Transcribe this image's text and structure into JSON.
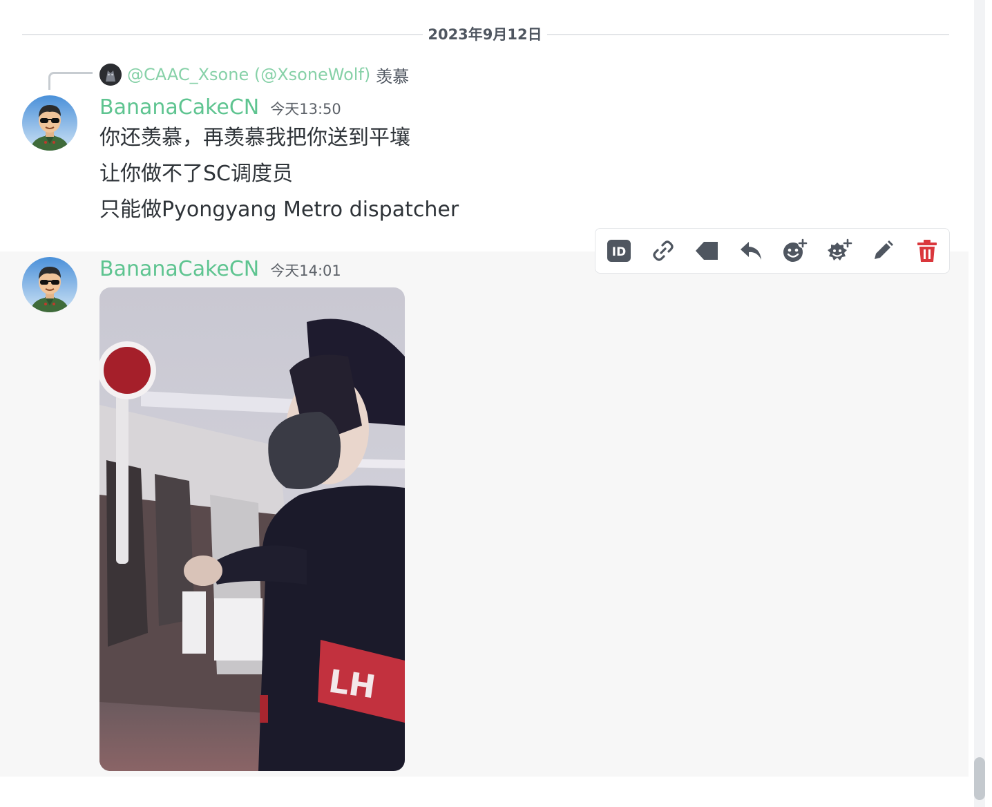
{
  "date_divider": "2023年9月12日",
  "messages": [
    {
      "reply": {
        "user": "@CAAC_Xsone (@XsoneWolf)",
        "text": "羡慕"
      },
      "author": "BananaCakeCN",
      "time": "今天13:50",
      "lines": [
        "你还羡慕，再羡慕我把你送到平壤",
        "让你做不了SC调度员",
        "只能做Pyongyang Metro dispatcher"
      ]
    },
    {
      "author": "BananaCakeCN",
      "time": "今天14:01",
      "attachment": "video-thumbnail"
    }
  ],
  "toolbar": {
    "buttons": [
      {
        "icon": "id-icon",
        "label": "ID",
        "color": "#4f5660"
      },
      {
        "icon": "link-icon",
        "color": "#4f5660"
      },
      {
        "icon": "tag-icon",
        "color": "#4f5660"
      },
      {
        "icon": "reply-icon",
        "color": "#4f5660"
      },
      {
        "icon": "add-reaction-icon",
        "color": "#4f5660"
      },
      {
        "icon": "add-super-reaction-icon",
        "color": "#4f5660"
      },
      {
        "icon": "edit-icon",
        "color": "#4f5660"
      },
      {
        "icon": "delete-icon",
        "color": "#da373c"
      }
    ]
  },
  "colors": {
    "username": "#5ec490",
    "reply_user": "#87d1a8",
    "hover_bg": "#f7f7f7",
    "danger": "#da373c"
  }
}
